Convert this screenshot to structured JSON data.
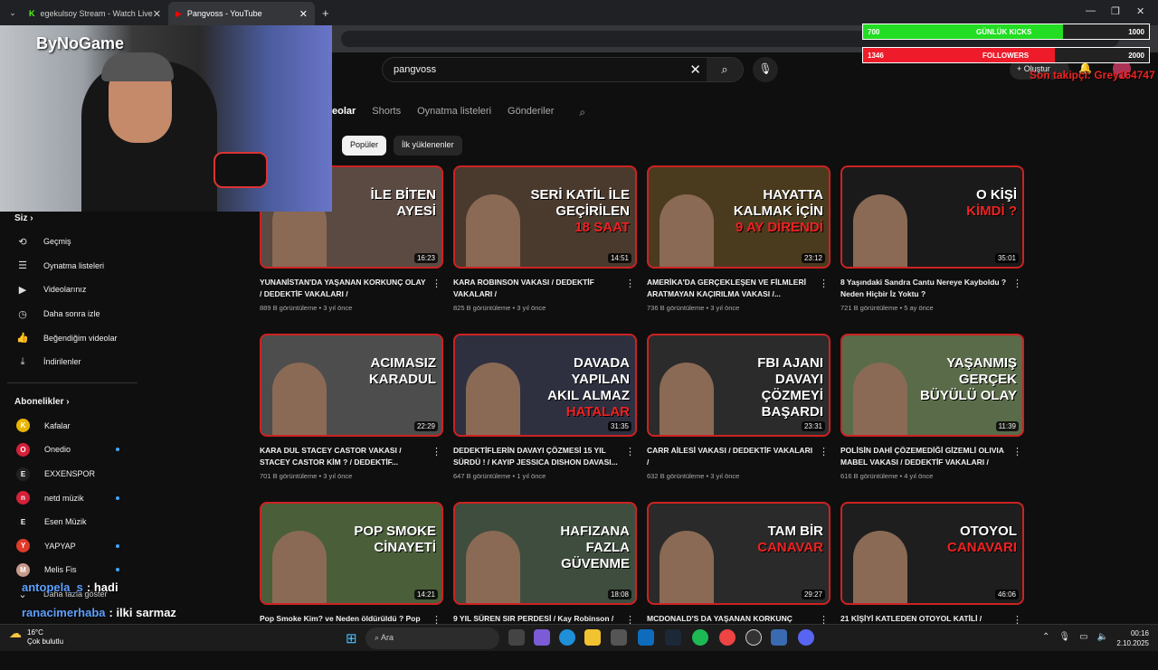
{
  "browser": {
    "tabs": [
      {
        "title": "egekulsoy Stream - Watch Live"
      },
      {
        "title": "Pangvoss - YouTube"
      }
    ],
    "new_tab": "+",
    "close": "✕"
  },
  "youtube": {
    "search": {
      "value": "pangvoss"
    },
    "create_label": "Oluştur",
    "channel_tabs": [
      "eolar",
      "Shorts",
      "Oynatma listeleri",
      "Gönderiler"
    ],
    "chips": [
      "Popüler",
      "İlk yüklenenler"
    ],
    "sidebar": {
      "siz_header": "Siz",
      "items": [
        {
          "label": "Geçmiş",
          "icon": "history-icon"
        },
        {
          "label": "Oynatma listeleri",
          "icon": "playlists-icon"
        },
        {
          "label": "Videolarınız",
          "icon": "your-videos-icon"
        },
        {
          "label": "Daha sonra izle",
          "icon": "watch-later-icon"
        },
        {
          "label": "Beğendiğim videolar",
          "icon": "liked-icon"
        },
        {
          "label": "İndirilenler",
          "icon": "downloads-icon"
        }
      ],
      "subs_header": "Abonelikler",
      "subs": [
        {
          "name": "Kafalar",
          "color": "#e8b500",
          "dot": false
        },
        {
          "name": "Onedio",
          "color": "#d5203a",
          "dot": true
        },
        {
          "name": "EXXENSPOR",
          "color": "#222222",
          "dot": false
        },
        {
          "name": "netd müzik",
          "color": "#d6203a",
          "dot": true
        },
        {
          "name": "Esen Müzik",
          "color": "#111111",
          "dot": false
        },
        {
          "name": "YAPYAP",
          "color": "#e03a2a",
          "dot": true
        },
        {
          "name": "Melis Fis",
          "color": "#c89a8a",
          "dot": true
        }
      ],
      "more": "Daha fazla göster"
    },
    "videos": [
      {
        "thumb_lines": [
          "İLE BİTEN",
          "AYESİ"
        ],
        "red_line": "",
        "duration": "16:23",
        "title": "YUNANİSTAN'DA YAŞANAN KORKUNÇ OLAY / DEDEKTİF VAKALARI /",
        "views": "889 B görüntüleme",
        "age": "3 yıl önce",
        "bg": "#5a4a42"
      },
      {
        "thumb_lines": [
          "SERİ KATİL İLE",
          "GEÇİRİLEN"
        ],
        "red_line": "18 SAAT",
        "duration": "14:51",
        "title": "KARA ROBINSON VAKASI / DEDEKTİF VAKALARI /",
        "views": "825 B görüntüleme",
        "age": "3 yıl önce",
        "bg": "#4a3a2e"
      },
      {
        "thumb_lines": [
          "HAYATTA",
          "KALMAK İÇİN"
        ],
        "red_line": "9 AY DİRENDİ",
        "duration": "23:12",
        "title": "AMERİKA'DA GERÇEKLEŞEN VE FİLMLERİ ARATMAYAN KAÇIRILMA VAKASI /...",
        "views": "736 B görüntüleme",
        "age": "3 yıl önce",
        "bg": "#4b3b1e"
      },
      {
        "thumb_lines": [
          "O KİŞİ"
        ],
        "red_line": "KİMDİ ?",
        "duration": "35:01",
        "title": "8 Yaşındaki Sandra Cantu Nereye Kayboldu ? Neden Hiçbir İz Yoktu ?",
        "views": "721 B görüntüleme",
        "age": "5 ay önce",
        "bg": "#1a1a1a"
      },
      {
        "thumb_lines": [
          "ACIMASIZ",
          "KARADUL"
        ],
        "red_line": "",
        "duration": "22:29",
        "title": "KARA DUL STACEY CASTOR VAKASI / STACEY CASTOR KİM ? / DEDEKTİF...",
        "views": "701 B görüntüleme",
        "age": "3 yıl önce",
        "bg": "#4d4d4d"
      },
      {
        "thumb_lines": [
          "DAVADA YAPILAN",
          "AKIL ALMAZ"
        ],
        "red_line": "HATALAR",
        "duration": "31:35",
        "title": "DEDEKTİFLERİN DAVAYI ÇÖZMESİ 15 YIL SÜRDÜ ! / KAYIP JESSICA DISHON DAVASI...",
        "views": "647 B görüntüleme",
        "age": "1 yıl önce",
        "bg": "#2e3040"
      },
      {
        "thumb_lines": [
          "FBI AJANI",
          "DAVAYI ÇÖZMEYİ",
          "BAŞARDI"
        ],
        "red_line": "",
        "duration": "23:31",
        "title": "CARR AİLESİ VAKASI / DEDEKTİF VAKALARI /",
        "views": "632 B görüntüleme",
        "age": "3 yıl önce",
        "bg": "#2b2b2b"
      },
      {
        "thumb_lines": [
          "YAŞANMIŞ GERÇEK",
          "BÜYÜLÜ OLAY"
        ],
        "red_line": "",
        "duration": "11:39",
        "title": "POLİSİN DAHİ ÇÖZEMEDİĞİ GİZEMLİ OLIVIA MABEL VAKASI / DEDEKTİF VAKALARI /",
        "views": "616 B görüntüleme",
        "age": "4 yıl önce",
        "bg": "#5a6b4a"
      },
      {
        "thumb_lines": [
          "POP SMOKE",
          "CİNAYETİ"
        ],
        "red_line": "",
        "duration": "14:21",
        "title": "Pop Smoke Kim? ve Neden öldürüldü ? Pop",
        "views": "",
        "age": "",
        "bg": "#4a5e3a"
      },
      {
        "thumb_lines": [
          "HAFIZANA",
          "FAZLA",
          "GÜVENME"
        ],
        "red_line": "",
        "duration": "18:08",
        "title": "9 YIL SÜREN SIR PERDESİ / Kay Robinson /",
        "views": "",
        "age": "",
        "bg": "#3e4d3e"
      },
      {
        "thumb_lines": [
          "TAM BİR"
        ],
        "red_line": "CANAVAR",
        "duration": "29:27",
        "title": "MCDONALD'S DA YAŞANAN KORKUNÇ",
        "views": "",
        "age": "",
        "bg": "#2a2a2a"
      },
      {
        "thumb_lines": [
          "OTOYOL"
        ],
        "red_line": "CANAVARI",
        "duration": "46:06",
        "title": "21 KİŞİYİ KATLEDEN OTOYOL KATİLİ /",
        "views": "",
        "age": "",
        "bg": "#1e1e1e"
      }
    ]
  },
  "overlay": {
    "logo": "ByNoGame",
    "kicks": {
      "left": "700",
      "label": "GÜNLÜK KICKS",
      "right": "1000",
      "progress": 0.7,
      "color": "#22dd22"
    },
    "followers": {
      "left": "1346",
      "label": "FOLLOWERS",
      "right": "2000",
      "progress": 0.67,
      "color": "#ee1c2a"
    },
    "last_follower": "Son takipçi: Grey164747",
    "chat": [
      {
        "user": "antopela_s",
        "msg": ": hadi"
      },
      {
        "user": "ranacimerhaba",
        "msg": ": ilki sarmaz"
      }
    ]
  },
  "taskbar": {
    "temp": "16°C",
    "weather": "Çok bulutlu",
    "search": "Ara",
    "time": "00:16",
    "date": "2.10.2025"
  }
}
